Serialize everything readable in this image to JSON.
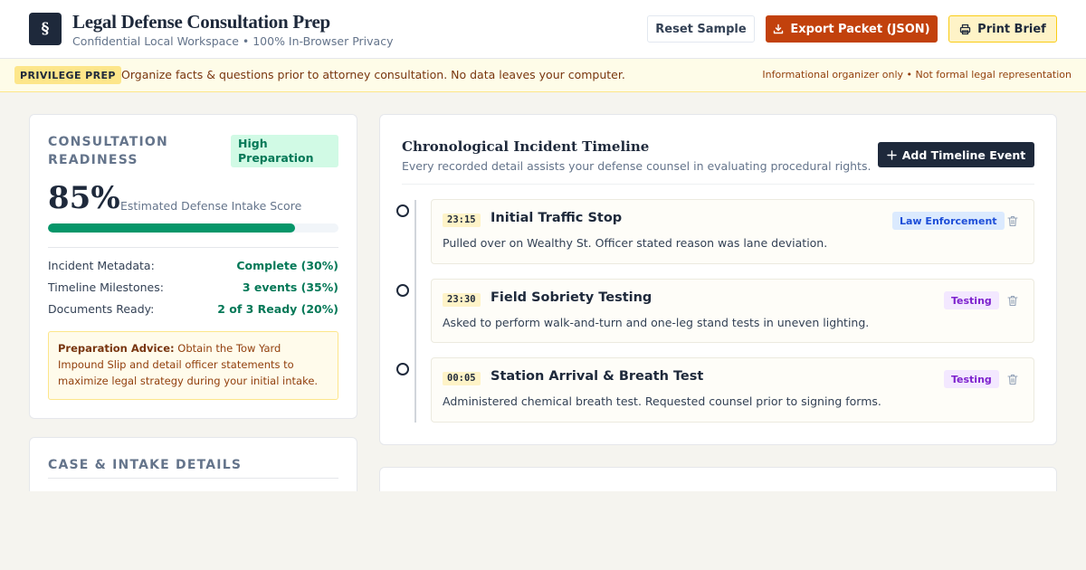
{
  "header": {
    "logo_glyph": "§",
    "title": "Legal Defense Consultation Prep",
    "subtitle": "Confidential Local Workspace • 100% In-Browser Privacy",
    "buttons": {
      "reset": "Reset Sample",
      "export": "Export Packet (JSON)",
      "print": "Print Brief"
    }
  },
  "banner": {
    "badge": "PRIVILEGE PREP",
    "text": "Organize facts & questions prior to attorney consultation. No data leaves your computer.",
    "note": "Informational organizer only • Not formal legal representation"
  },
  "readiness": {
    "heading": "CONSULTATION READINESS",
    "badge": "High Preparation",
    "score": "85%",
    "score_fraction": 0.85,
    "score_label": "Estimated Defense Intake Score",
    "metrics": [
      {
        "label": "Incident Metadata:",
        "value": "Complete (30%)"
      },
      {
        "label": "Timeline Milestones:",
        "value": "3 events (35%)"
      },
      {
        "label": "Documents Ready:",
        "value": "2 of 3 Ready (20%)"
      }
    ],
    "advice_title": "Preparation Advice:",
    "advice_text": "Obtain the Tow Yard Impound Slip and detail officer statements to maximize legal strategy during your initial intake."
  },
  "details": {
    "heading": "CASE & INTAKE DETAILS"
  },
  "timeline": {
    "title": "Chronological Incident Timeline",
    "subtitle": "Every recorded detail assists your defense counsel in evaluating procedural rights.",
    "add_button": "Add Timeline Event",
    "events": [
      {
        "time": "23:15",
        "title": "Initial Traffic Stop",
        "tag": "Law Enforcement",
        "tag_type": "law",
        "description": "Pulled over on Wealthy St. Officer stated reason was lane deviation."
      },
      {
        "time": "23:30",
        "title": "Field Sobriety Testing",
        "tag": "Testing",
        "tag_type": "testing",
        "description": "Asked to perform walk-and-turn and one-leg stand tests in uneven lighting."
      },
      {
        "time": "00:05",
        "title": "Station Arrival & Breath Test",
        "tag": "Testing",
        "tag_type": "testing",
        "description": "Administered chemical breath test. Requested counsel prior to signing forms."
      }
    ]
  },
  "colors": {
    "brand_dark": "#1e293b",
    "export_orange": "#c2410c",
    "progress_green": "#059669",
    "banner_bg": "#fefce8",
    "law_tag": "#dbeafe",
    "testing_tag": "#f3e8ff"
  },
  "icons": {
    "export": "download-icon",
    "print": "printer-icon",
    "add": "plus-icon",
    "delete": "trash-icon"
  }
}
